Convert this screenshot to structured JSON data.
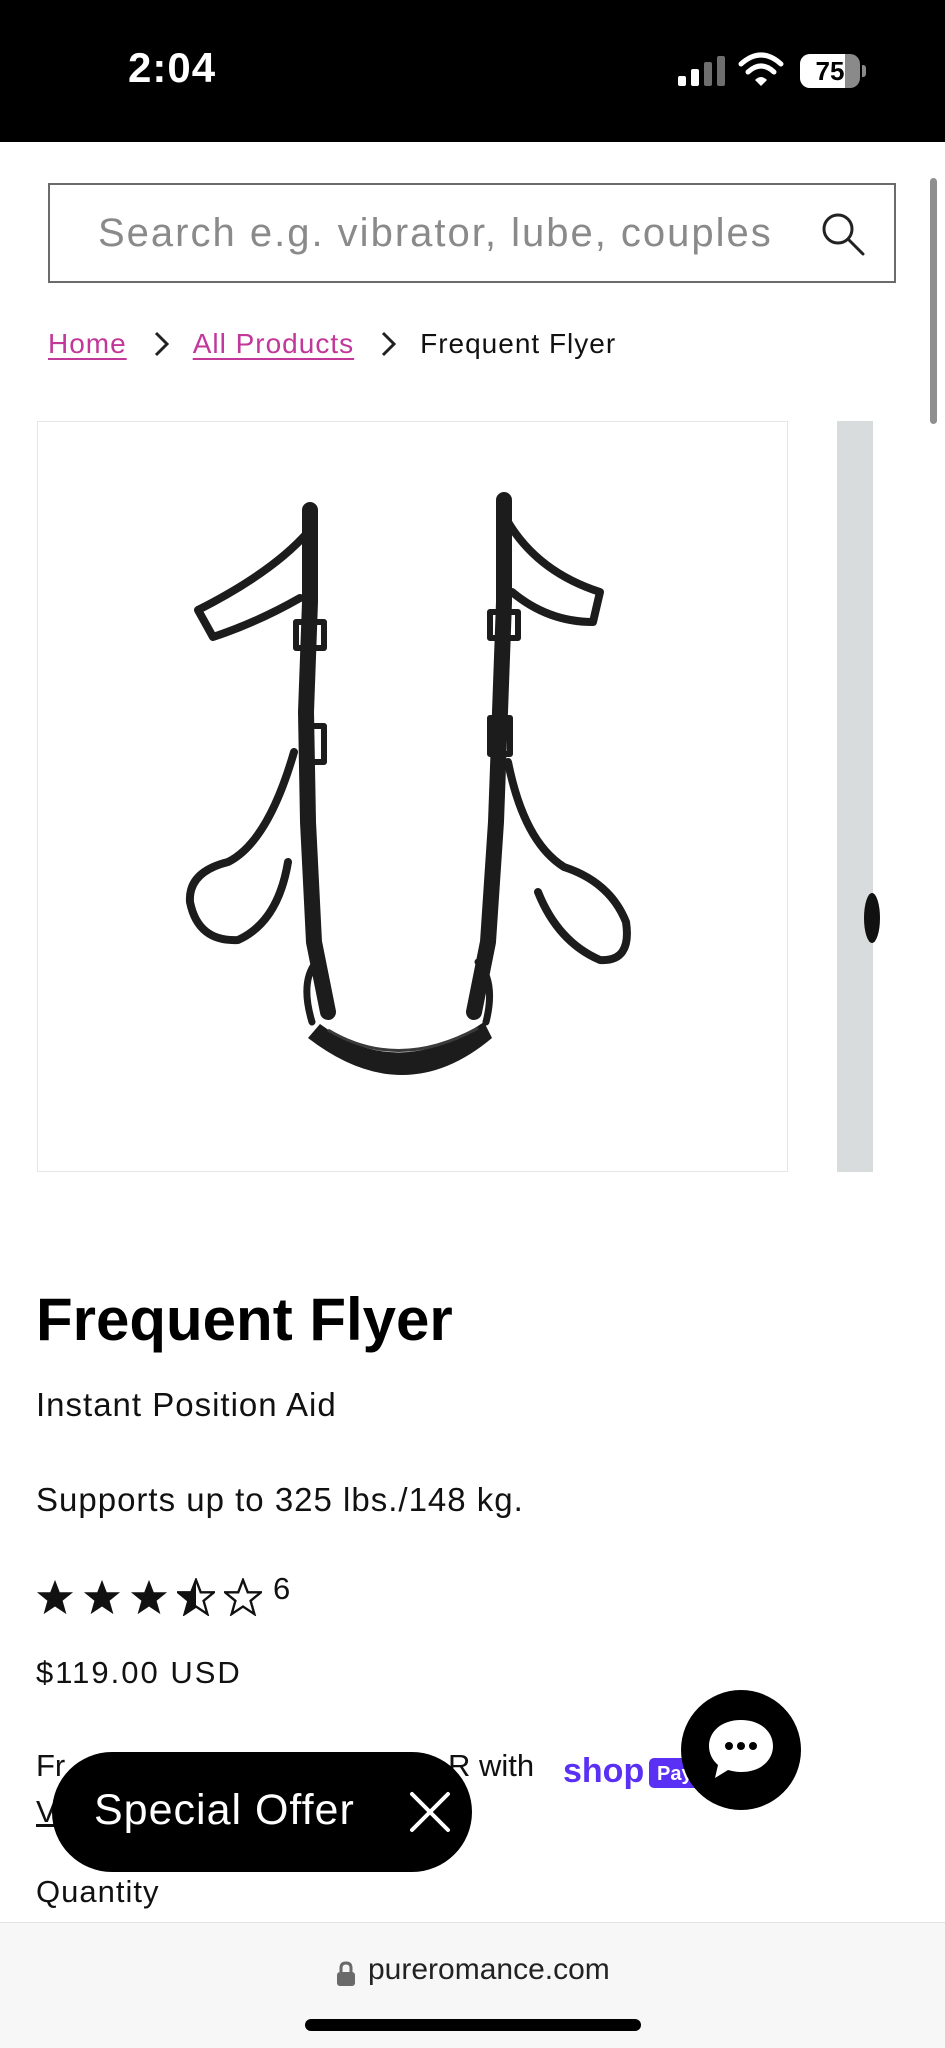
{
  "status_bar": {
    "time": "2:04",
    "battery_level": "75",
    "battery_fraction": 0.75
  },
  "search": {
    "placeholder": "Search e.g. vibrator, lube, couples"
  },
  "breadcrumb": {
    "home": "Home",
    "all_products": "All Products",
    "current": "Frequent Flyer"
  },
  "product": {
    "title": "Frequent Flyer",
    "subtitle": "Instant Position Aid",
    "weight_limit": "Supports up to 325 lbs./148 kg.",
    "rating": 3.5,
    "rating_max": 5,
    "review_count": "6",
    "price": "$119.00 USD",
    "installments_text": "Fr",
    "installments_text_after": "R with",
    "view_link": "V"
  },
  "shop_pay": {
    "word": "shop",
    "badge": "Pay",
    "color": "#5a31f4"
  },
  "quantity": {
    "label": "Quantity"
  },
  "special_offer": {
    "label": "Special Offer"
  },
  "browser": {
    "url": "pureromance.com"
  },
  "colors": {
    "link": "#c2379a",
    "status_bar": "#000000",
    "image_panel_next": "#d9dcdc"
  },
  "icons": {
    "search": "search-icon",
    "chevron": "chevron-right-icon",
    "close": "close-icon",
    "chat": "chat-bubble-icon",
    "lock": "lock-icon"
  }
}
